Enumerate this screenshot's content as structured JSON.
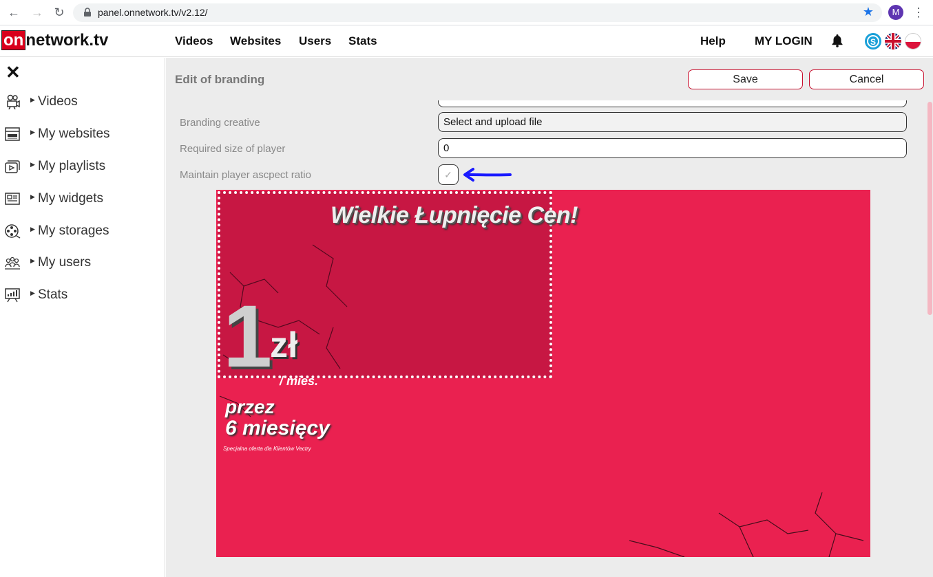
{
  "browser": {
    "url": "panel.onnetwork.tv/v2.12/",
    "profile_initial": "M",
    "back_icon": "arrow-left-icon",
    "forward_icon": "arrow-right-icon",
    "reload_icon": "reload-icon"
  },
  "header": {
    "logo_prefix": "on",
    "logo_rest": "network.tv",
    "nav": [
      "Videos",
      "Websites",
      "Users",
      "Stats"
    ],
    "help": "Help",
    "login": "MY LOGIN"
  },
  "sidebar": {
    "items": [
      {
        "label": "Videos",
        "icon": "camera-icon"
      },
      {
        "label": "My websites",
        "icon": "browser-window-icon"
      },
      {
        "label": "My playlists",
        "icon": "playlist-icon"
      },
      {
        "label": "My widgets",
        "icon": "widget-icon"
      },
      {
        "label": "My storages",
        "icon": "film-reel-icon"
      },
      {
        "label": "My users",
        "icon": "users-icon"
      },
      {
        "label": "Stats",
        "icon": "chart-icon"
      }
    ]
  },
  "panel": {
    "title": "Edit of branding",
    "save": "Save",
    "cancel": "Cancel",
    "fields": {
      "creative_label": "Branding creative",
      "creative_value": "Select and upload file",
      "size_label": "Required size of player",
      "size_value": "0",
      "ratio_label": "Maintain player ascpect ratio",
      "ratio_checked": true
    }
  },
  "preview": {
    "headline": "Wielkie Łupnięcie Cen!",
    "price_number": "1",
    "price_currency": "zł",
    "price_unit": "/ mies.",
    "promo_line1": "przez",
    "promo_line2": "6 miesięcy",
    "promo_small": "Specjalna oferta dla Klientów Vectry"
  },
  "colors": {
    "brand_red": "#d9001b",
    "button_border": "#c8102e",
    "preview_bg": "#ea2150",
    "arrow": "#1a1aff"
  }
}
